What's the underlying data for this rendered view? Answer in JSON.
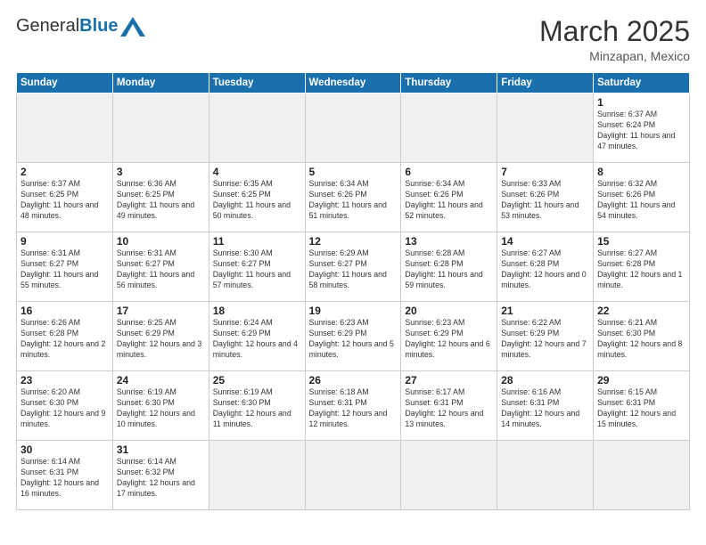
{
  "header": {
    "logo_general": "General",
    "logo_blue": "Blue",
    "month_title": "March 2025",
    "location": "Minzapan, Mexico"
  },
  "weekdays": [
    "Sunday",
    "Monday",
    "Tuesday",
    "Wednesday",
    "Thursday",
    "Friday",
    "Saturday"
  ],
  "weeks": [
    [
      {
        "day": "",
        "empty": true
      },
      {
        "day": "",
        "empty": true
      },
      {
        "day": "",
        "empty": true
      },
      {
        "day": "",
        "empty": true
      },
      {
        "day": "",
        "empty": true
      },
      {
        "day": "",
        "empty": true
      },
      {
        "day": "1",
        "sunrise": "6:37 AM",
        "sunset": "6:24 PM",
        "daylight": "11 hours and 47 minutes."
      }
    ],
    [
      {
        "day": "2",
        "sunrise": "6:37 AM",
        "sunset": "6:25 PM",
        "daylight": "11 hours and 48 minutes."
      },
      {
        "day": "3",
        "sunrise": "6:36 AM",
        "sunset": "6:25 PM",
        "daylight": "11 hours and 49 minutes."
      },
      {
        "day": "4",
        "sunrise": "6:35 AM",
        "sunset": "6:25 PM",
        "daylight": "11 hours and 50 minutes."
      },
      {
        "day": "5",
        "sunrise": "6:34 AM",
        "sunset": "6:26 PM",
        "daylight": "11 hours and 51 minutes."
      },
      {
        "day": "6",
        "sunrise": "6:34 AM",
        "sunset": "6:26 PM",
        "daylight": "11 hours and 52 minutes."
      },
      {
        "day": "7",
        "sunrise": "6:33 AM",
        "sunset": "6:26 PM",
        "daylight": "11 hours and 53 minutes."
      },
      {
        "day": "8",
        "sunrise": "6:32 AM",
        "sunset": "6:26 PM",
        "daylight": "11 hours and 54 minutes."
      }
    ],
    [
      {
        "day": "9",
        "sunrise": "6:31 AM",
        "sunset": "6:27 PM",
        "daylight": "11 hours and 55 minutes."
      },
      {
        "day": "10",
        "sunrise": "6:31 AM",
        "sunset": "6:27 PM",
        "daylight": "11 hours and 56 minutes."
      },
      {
        "day": "11",
        "sunrise": "6:30 AM",
        "sunset": "6:27 PM",
        "daylight": "11 hours and 57 minutes."
      },
      {
        "day": "12",
        "sunrise": "6:29 AM",
        "sunset": "6:27 PM",
        "daylight": "11 hours and 58 minutes."
      },
      {
        "day": "13",
        "sunrise": "6:28 AM",
        "sunset": "6:28 PM",
        "daylight": "11 hours and 59 minutes."
      },
      {
        "day": "14",
        "sunrise": "6:27 AM",
        "sunset": "6:28 PM",
        "daylight": "12 hours and 0 minutes."
      },
      {
        "day": "15",
        "sunrise": "6:27 AM",
        "sunset": "6:28 PM",
        "daylight": "12 hours and 1 minute."
      }
    ],
    [
      {
        "day": "16",
        "sunrise": "6:26 AM",
        "sunset": "6:28 PM",
        "daylight": "12 hours and 2 minutes."
      },
      {
        "day": "17",
        "sunrise": "6:25 AM",
        "sunset": "6:29 PM",
        "daylight": "12 hours and 3 minutes."
      },
      {
        "day": "18",
        "sunrise": "6:24 AM",
        "sunset": "6:29 PM",
        "daylight": "12 hours and 4 minutes."
      },
      {
        "day": "19",
        "sunrise": "6:23 AM",
        "sunset": "6:29 PM",
        "daylight": "12 hours and 5 minutes."
      },
      {
        "day": "20",
        "sunrise": "6:23 AM",
        "sunset": "6:29 PM",
        "daylight": "12 hours and 6 minutes."
      },
      {
        "day": "21",
        "sunrise": "6:22 AM",
        "sunset": "6:29 PM",
        "daylight": "12 hours and 7 minutes."
      },
      {
        "day": "22",
        "sunrise": "6:21 AM",
        "sunset": "6:30 PM",
        "daylight": "12 hours and 8 minutes."
      }
    ],
    [
      {
        "day": "23",
        "sunrise": "6:20 AM",
        "sunset": "6:30 PM",
        "daylight": "12 hours and 9 minutes."
      },
      {
        "day": "24",
        "sunrise": "6:19 AM",
        "sunset": "6:30 PM",
        "daylight": "12 hours and 10 minutes."
      },
      {
        "day": "25",
        "sunrise": "6:19 AM",
        "sunset": "6:30 PM",
        "daylight": "12 hours and 11 minutes."
      },
      {
        "day": "26",
        "sunrise": "6:18 AM",
        "sunset": "6:31 PM",
        "daylight": "12 hours and 12 minutes."
      },
      {
        "day": "27",
        "sunrise": "6:17 AM",
        "sunset": "6:31 PM",
        "daylight": "12 hours and 13 minutes."
      },
      {
        "day": "28",
        "sunrise": "6:16 AM",
        "sunset": "6:31 PM",
        "daylight": "12 hours and 14 minutes."
      },
      {
        "day": "29",
        "sunrise": "6:15 AM",
        "sunset": "6:31 PM",
        "daylight": "12 hours and 15 minutes."
      }
    ],
    [
      {
        "day": "30",
        "sunrise": "6:14 AM",
        "sunset": "6:31 PM",
        "daylight": "12 hours and 16 minutes."
      },
      {
        "day": "31",
        "sunrise": "6:14 AM",
        "sunset": "6:32 PM",
        "daylight": "12 hours and 17 minutes."
      },
      {
        "day": "",
        "empty": true
      },
      {
        "day": "",
        "empty": true
      },
      {
        "day": "",
        "empty": true
      },
      {
        "day": "",
        "empty": true
      },
      {
        "day": "",
        "empty": true
      }
    ]
  ]
}
